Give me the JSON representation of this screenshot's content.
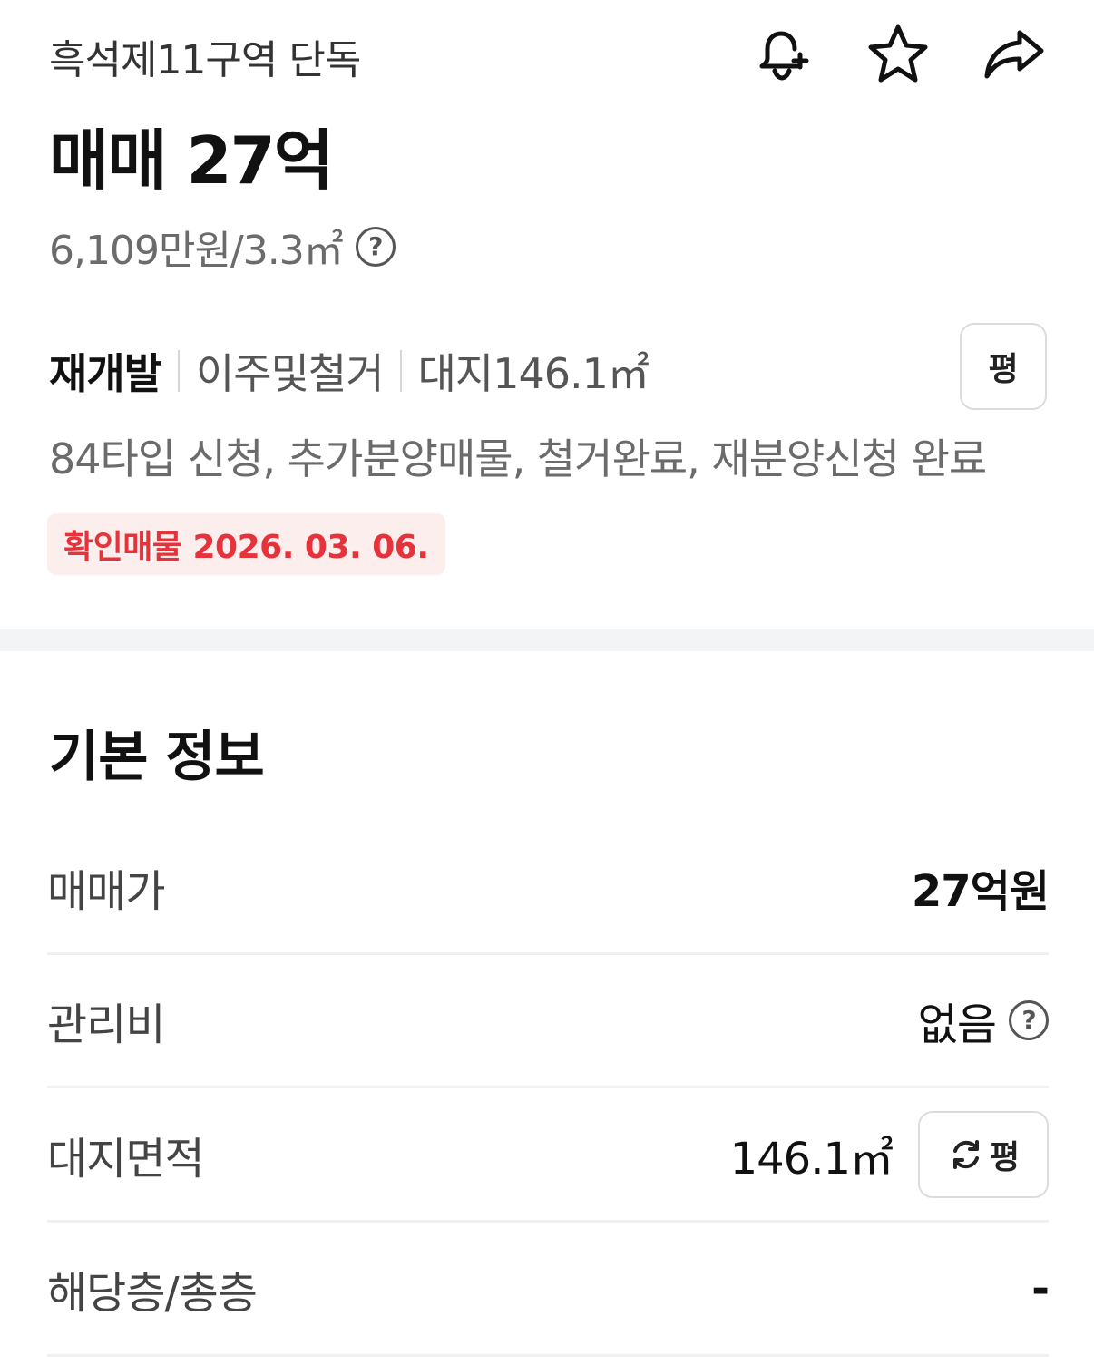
{
  "header": {
    "listing_name": "흑석제11구역 단독",
    "price_title": "매매 27억",
    "price_per_area": "6,109만원/3.3㎡",
    "help_glyph": "?",
    "actions": [
      {
        "icon": "bell-plus-icon"
      },
      {
        "icon": "star-icon"
      },
      {
        "icon": "share-icon"
      }
    ]
  },
  "tags": {
    "primary": "재개발",
    "stage": "이주및철거",
    "land": "대지146.1㎡",
    "unit_toggle": "평"
  },
  "features": "84타입 신청, 추가분양매물, 철거완료, 재분양신청 완료",
  "verified": "확인매물 2026. 03. 06.",
  "basic_info": {
    "title": "기본 정보",
    "rows": [
      {
        "label": "매매가",
        "value": "27억원"
      },
      {
        "label": "관리비",
        "value": "없음"
      },
      {
        "label": "대지면적",
        "value": "146.1㎡",
        "toggle": "평"
      },
      {
        "label": "해당층/총층",
        "value": "-"
      }
    ]
  },
  "colors": {
    "accent_red": "#e5323b",
    "badge_bg": "#fdeeee",
    "divider": "#f3f4f6"
  }
}
